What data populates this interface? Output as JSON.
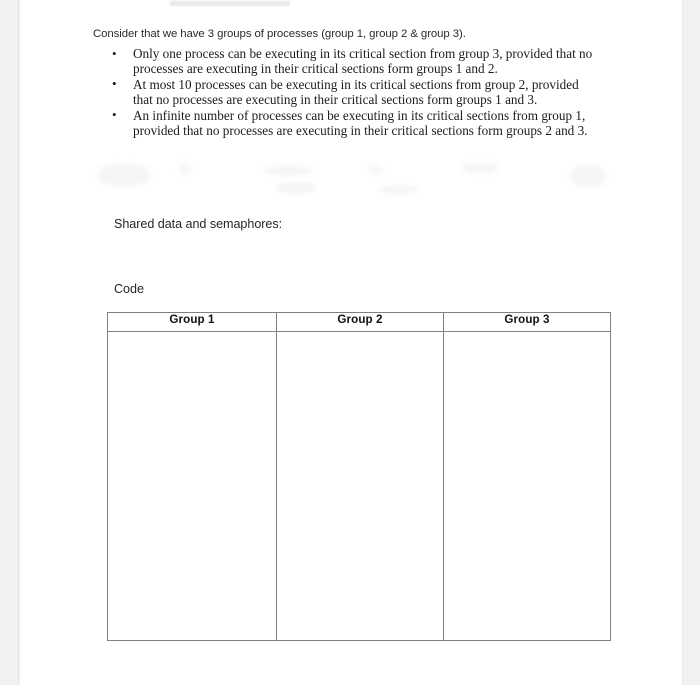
{
  "document": {
    "intro_paragraph": "Consider that we have 3 groups of processes (group 1, group 2 & group 3).",
    "rules": [
      {
        "bullet_glyph": "•",
        "text": "Only one process can be executing in its critical section from group 3, provided that no processes are executing in their critical sections form groups 1 and 2."
      },
      {
        "bullet_glyph": "•",
        "text": "At most 10 processes can be executing in its critical sections from group 2, provided that no processes are executing in their critical sections form groups 1 and 3."
      },
      {
        "bullet_glyph": "•",
        "text": "An infinite number of processes can be executing in its critical sections from group 1, provided that no processes are executing in their critical sections form groups 2 and 3."
      }
    ],
    "shared_data_label": "Shared data and semaphores:",
    "code_label": "Code",
    "code_table": {
      "headers": [
        "Group 1",
        "Group 2",
        "Group 3"
      ],
      "rows": [
        [
          "",
          "",
          ""
        ]
      ]
    }
  }
}
